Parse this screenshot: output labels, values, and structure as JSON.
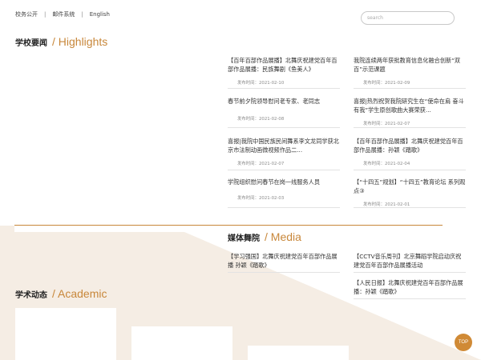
{
  "topbar": {
    "links": [
      "校务公开",
      "邮件系统",
      "English"
    ],
    "separator": "|"
  },
  "search": {
    "placeholder": "search"
  },
  "highlights": {
    "title_cn": "学校要闻",
    "title_en": "/ Highlights",
    "left": [
      {
        "title": "【百年百部作品展播】北舞庆祝建党百年百部作品展播：民族舞剧《鱼美人》",
        "date": "发布时间：2021-02-10"
      },
      {
        "title": "春节前夕院领导慰问老专家、老同志",
        "date": "发布时间：2021-02-08"
      },
      {
        "title": "喜报|我院中国民族民间舞系李文龙同学获北京市法制动画微视频作品二...",
        "date": "发布时间：2021-02-07"
      },
      {
        "title": "学院组织慰问春节在岗一线服务人员",
        "date": "发布时间：2021-02-03"
      }
    ],
    "right": [
      {
        "title": "我院连续两年获批教育信息化融合创新“双百”示范课题",
        "date": "发布时间：2021-02-09"
      },
      {
        "title": "喜报|热烈祝贺我院研究生在“使命在肩 奋斗有我”学生原创歌曲大赛荣获...",
        "date": "发布时间：2021-02-07"
      },
      {
        "title": "【百年百部作品展播】北舞庆祝建党百年百部作品展播：孙颖《踏歌》",
        "date": "发布时间：2021-02-04"
      },
      {
        "title": "【“十四五”规划】“十四五”教育论坛 系列观点③",
        "date": "发布时间：2021-02-01"
      }
    ]
  },
  "media": {
    "title_cn": "媒体舞院",
    "title_en": "/ Media",
    "left": [
      {
        "title": "【学习强国】北舞庆祝建党百年百部作品展播 孙颖《踏歌》"
      }
    ],
    "right": [
      {
        "title": "【CCTV音乐周刊】北京舞蹈学院启动庆祝建党百年百部作品展播活动"
      },
      {
        "title": "【人民日报】北舞庆祝建党百年百部作品展播：孙颖《踏歌》"
      }
    ]
  },
  "academic": {
    "title_cn": "学术动态",
    "title_en": "/ Academic"
  },
  "top_button": {
    "label": "TOP"
  },
  "colors": {
    "accent": "#c8873a",
    "beige": "#f5ede4",
    "top_button": "#d08a36"
  }
}
